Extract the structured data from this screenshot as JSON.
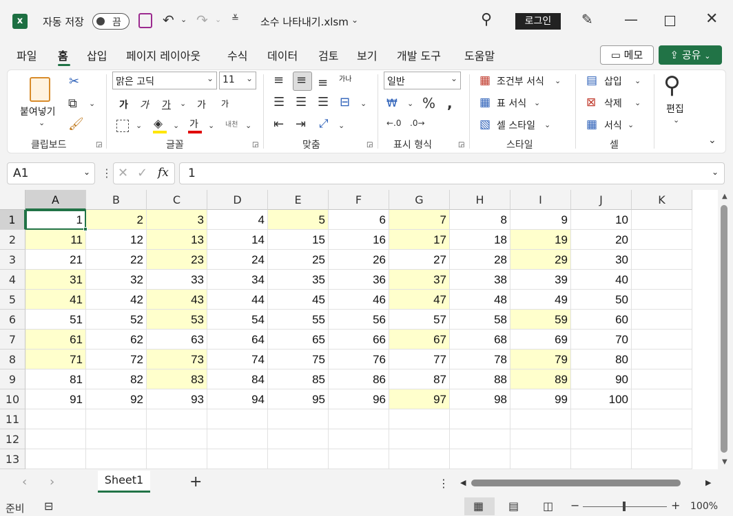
{
  "titlebar": {
    "autosave_label": "자동 저장",
    "autosave_state": "끔",
    "filename": "소수 나타내기.xlsm",
    "login": "로그인"
  },
  "tabs": [
    "파일",
    "홈",
    "삽입",
    "페이지 레이아웃",
    "수식",
    "데이터",
    "검토",
    "보기",
    "개발 도구",
    "도움말"
  ],
  "memo": "메모",
  "share": "공유",
  "ribbon": {
    "clipboard": {
      "paste": "붙여넣기",
      "label": "클립보드"
    },
    "font": {
      "name": "맑은 고딕",
      "size": "11",
      "label": "글꼴",
      "bold": "가",
      "italic": "가",
      "underline": "가",
      "grow": "가",
      "shrink": "가",
      "color_glyph": "가",
      "phonetic": "내천"
    },
    "align": {
      "label": "맞춤",
      "wrap": "가나"
    },
    "number": {
      "format": "일반",
      "label": "표시 형식"
    },
    "styles": {
      "conditional": "조건부 서식",
      "table": "표 서식",
      "cell": "셀 스타일",
      "label": "스타일"
    },
    "cells": {
      "insert": "삽입",
      "delete": "삭제",
      "format": "서식",
      "label": "셀"
    },
    "edit": {
      "label": "편집"
    }
  },
  "formula_bar": {
    "namebox": "A1",
    "fx": "fx",
    "value": "1"
  },
  "columns": [
    "A",
    "B",
    "C",
    "D",
    "E",
    "F",
    "G",
    "H",
    "I",
    "J",
    "K"
  ],
  "rows": [
    "1",
    "2",
    "3",
    "4",
    "5",
    "6",
    "7",
    "8",
    "9",
    "10",
    "11",
    "12",
    "13"
  ],
  "cells": [
    [
      "1",
      "2",
      "3",
      "4",
      "5",
      "6",
      "7",
      "8",
      "9",
      "10"
    ],
    [
      "11",
      "12",
      "13",
      "14",
      "15",
      "16",
      "17",
      "18",
      "19",
      "20"
    ],
    [
      "21",
      "22",
      "23",
      "24",
      "25",
      "26",
      "27",
      "28",
      "29",
      "30"
    ],
    [
      "31",
      "32",
      "33",
      "34",
      "35",
      "36",
      "37",
      "38",
      "39",
      "40"
    ],
    [
      "41",
      "42",
      "43",
      "44",
      "45",
      "46",
      "47",
      "48",
      "49",
      "50"
    ],
    [
      "51",
      "52",
      "53",
      "54",
      "55",
      "56",
      "57",
      "58",
      "59",
      "60"
    ],
    [
      "61",
      "62",
      "63",
      "64",
      "65",
      "66",
      "67",
      "68",
      "69",
      "70"
    ],
    [
      "71",
      "72",
      "73",
      "74",
      "75",
      "76",
      "77",
      "78",
      "79",
      "80"
    ],
    [
      "81",
      "82",
      "83",
      "84",
      "85",
      "86",
      "87",
      "88",
      "89",
      "90"
    ],
    [
      "91",
      "92",
      "93",
      "94",
      "95",
      "96",
      "97",
      "98",
      "99",
      "100"
    ]
  ],
  "highlighted_cells": [
    "B1",
    "C1",
    "E1",
    "G1",
    "A2",
    "C2",
    "G2",
    "I2",
    "C3",
    "I3",
    "A4",
    "G4",
    "A5",
    "C5",
    "G5",
    "C6",
    "I6",
    "A7",
    "G7",
    "A8",
    "C8",
    "I8",
    "C9",
    "I9",
    "G10"
  ],
  "highlight_color": "#ffffcc",
  "accent_color": "#217346",
  "sheet_tab": "Sheet1",
  "status": {
    "ready": "준비",
    "zoom": "100%"
  }
}
